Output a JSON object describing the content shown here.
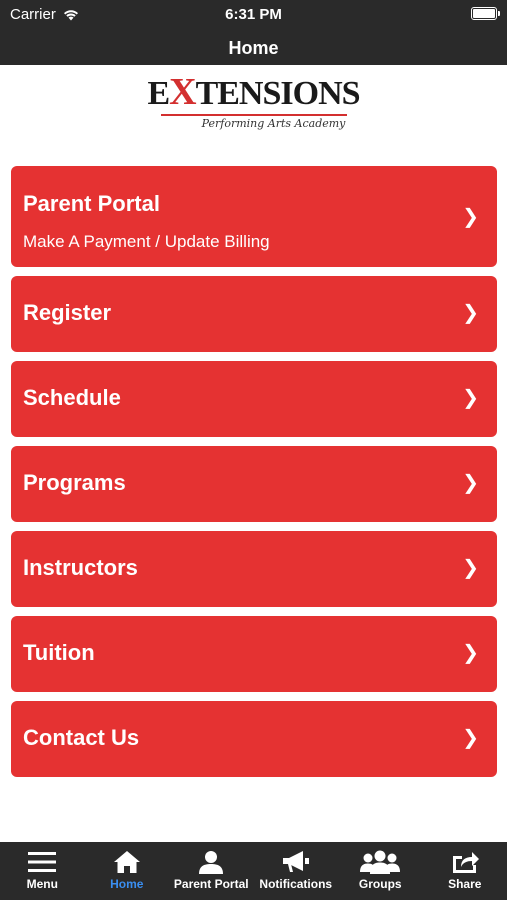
{
  "status_bar": {
    "carrier": "Carrier",
    "time": "6:31 PM"
  },
  "nav": {
    "title": "Home"
  },
  "logo": {
    "main_prefix": "E",
    "main_x": "X",
    "main_suffix": "TENSIONS",
    "subtitle": "Performing Arts Academy"
  },
  "menu": [
    {
      "label": "Parent Portal",
      "sub": "Make A Payment / Update Billing",
      "chevron": "❯"
    },
    {
      "label": "Register",
      "chevron": "❯"
    },
    {
      "label": "Schedule",
      "chevron": "❯"
    },
    {
      "label": "Programs",
      "chevron": "❯"
    },
    {
      "label": "Instructors",
      "chevron": "❯"
    },
    {
      "label": "Tuition",
      "chevron": "❯"
    },
    {
      "label": "Contact Us",
      "chevron": "❯"
    }
  ],
  "tabs": [
    {
      "label": "Menu",
      "icon": "hamburger-icon"
    },
    {
      "label": "Home",
      "icon": "home-icon",
      "active": true
    },
    {
      "label": "Parent Portal",
      "icon": "person-icon"
    },
    {
      "label": "Notifications",
      "icon": "megaphone-icon"
    },
    {
      "label": "Groups",
      "icon": "group-icon"
    },
    {
      "label": "Share",
      "icon": "share-icon"
    }
  ],
  "colors": {
    "accent": "#e53232",
    "bar": "#2a2a2a",
    "active_tab": "#3a8ef0"
  }
}
